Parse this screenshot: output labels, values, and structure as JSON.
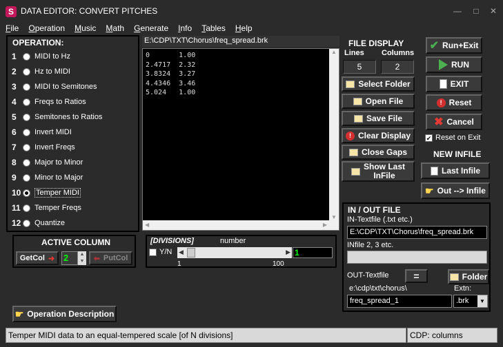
{
  "window": {
    "title": "DATA EDITOR: CONVERT PITCHES",
    "icon_letter": "S",
    "controls": [
      "—",
      "□",
      "✕"
    ]
  },
  "menu": [
    "File",
    "Operation",
    "Music",
    "Math",
    "Generate",
    "Info",
    "Tables",
    "Help"
  ],
  "operation": {
    "title": "OPERATION:",
    "items": [
      {
        "num": "1",
        "label": "MIDI to Hz"
      },
      {
        "num": "2",
        "label": "Hz to MIDI"
      },
      {
        "num": "3",
        "label": "MIDI to Semitones"
      },
      {
        "num": "4",
        "label": "Freqs to Ratios"
      },
      {
        "num": "5",
        "label": "Semitones to Ratios"
      },
      {
        "num": "6",
        "label": "Invert MIDI"
      },
      {
        "num": "7",
        "label": "Invert Freqs"
      },
      {
        "num": "8",
        "label": "Major to Minor"
      },
      {
        "num": "9",
        "label": "Minor to Major"
      },
      {
        "num": "10",
        "label": "Temper MIDI"
      },
      {
        "num": "11",
        "label": "Temper Freqs"
      },
      {
        "num": "12",
        "label": "Quantize"
      }
    ],
    "selected_index": 9
  },
  "display": {
    "path": "E:\\CDP\\TXT\\Chorus\\freq_spread.brk",
    "lines": [
      "0       1.00",
      "2.4717  2.32",
      "3.8324  3.27",
      "4.4346  3.46",
      "5.024   1.00"
    ]
  },
  "file_display": {
    "title": "FILE DISPLAY",
    "lines_label": "Lines",
    "columns_label": "Columns",
    "lines_value": "5",
    "columns_value": "2",
    "buttons": {
      "select_folder": "Select Folder",
      "open_file": "Open File",
      "save_file": "Save File",
      "clear_display": "Clear Display",
      "close_gaps": "Close Gaps",
      "show_last_infile_1": "Show Last",
      "show_last_infile_2": "InFile"
    }
  },
  "actions": {
    "run_exit": "Run+Exit",
    "run": "RUN",
    "exit": "EXIT",
    "reset": "Reset",
    "cancel": "Cancel",
    "reset_on_exit": "Reset on Exit",
    "reset_on_exit_checked": true
  },
  "new_infile": {
    "title": "NEW INFILE",
    "last_infile": "Last Infile",
    "out_to_infile": "Out --> Infile"
  },
  "active_column": {
    "title": "ACTIVE COLUMN",
    "getcol": "GetCol",
    "value": "2",
    "putcol": "PutCol"
  },
  "divisions": {
    "title": "[DIVISIONS]",
    "sub": "number",
    "yn_label": "Y/N",
    "min": "1",
    "max": "100",
    "value": "1",
    "level_fraction": 0.0
  },
  "io": {
    "title": "IN / OUT FILE",
    "in_label": "IN-Textfile (.txt etc.)",
    "in_value": "E:\\CDP\\TXT\\Chorus\\freq_spread.brk",
    "in2_label": "INfile 2, 3 etc.",
    "in2_value": "",
    "out_label": "OUT-Textfile",
    "equals": "=",
    "folder": "Folder",
    "out_path": "e:\\cdp\\txt\\chorus\\",
    "extn_label": "Extn:",
    "out_value": "freq_spread_1",
    "extn_value": ".brk"
  },
  "op_desc": "Operation Description",
  "status": {
    "message": "Temper MIDI data to an equal-tempered scale [of N divisions]",
    "right": "CDP:  columns"
  },
  "colors": {
    "bg": "#2b2b2b",
    "accent_green": "#4caf50",
    "accent_red": "#e53935",
    "text_value_green": "#00ff00"
  }
}
